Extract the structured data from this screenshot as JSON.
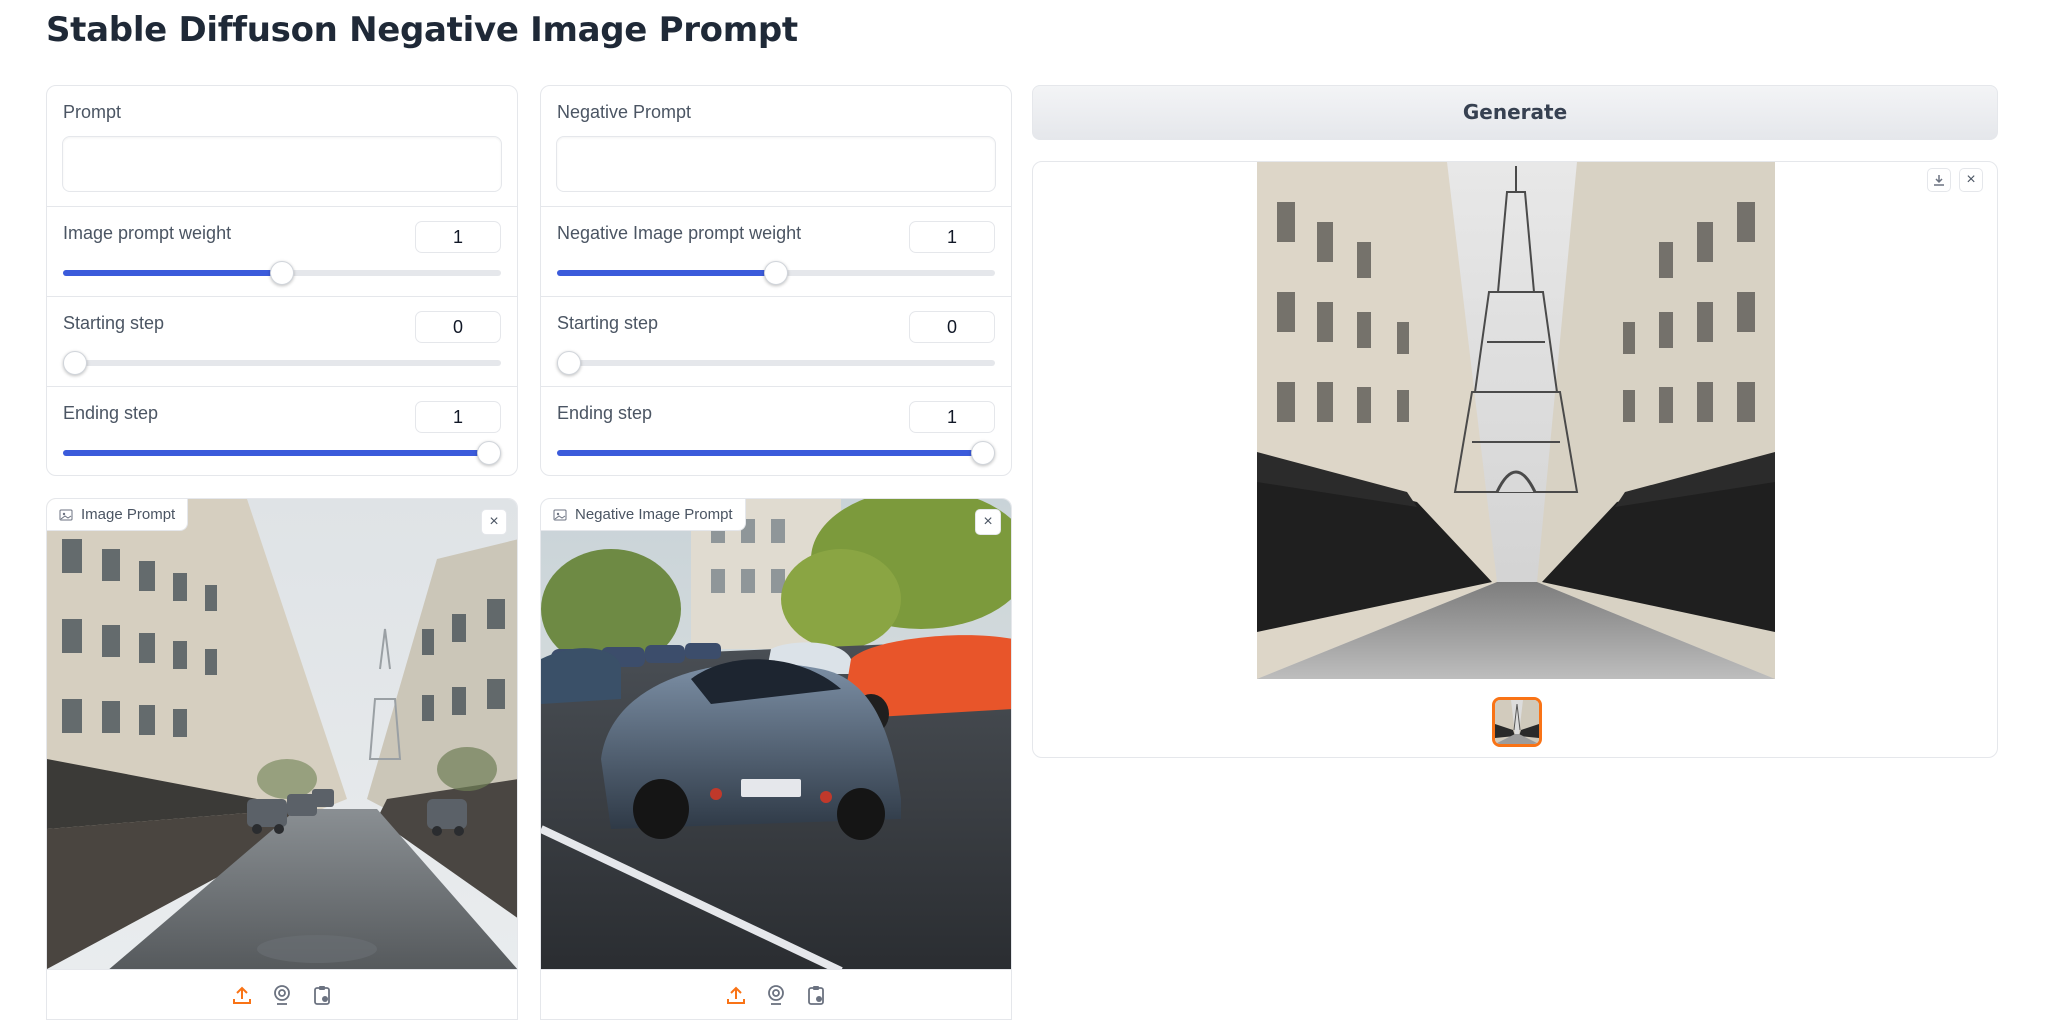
{
  "page": {
    "title": "Stable Diffuson Negative Image Prompt"
  },
  "left_controls": {
    "prompt_label": "Prompt",
    "prompt_value": "",
    "weight_label": "Image prompt weight",
    "weight_value": "1",
    "weight_fraction": 0.5,
    "start_label": "Starting step",
    "start_value": "0",
    "start_fraction": 0.0,
    "end_label": "Ending step",
    "end_value": "1",
    "end_fraction": 1.0
  },
  "right_controls": {
    "prompt_label": "Negative Prompt",
    "prompt_value": "",
    "weight_label": "Negative Image prompt weight",
    "weight_value": "1",
    "weight_fraction": 0.5,
    "start_label": "Starting step",
    "start_value": "0",
    "start_fraction": 0.0,
    "end_label": "Ending step",
    "end_value": "1",
    "end_fraction": 1.0
  },
  "generate": {
    "label": "Generate"
  },
  "image_prompt": {
    "label": "Image Prompt",
    "close": "×"
  },
  "negative_image_prompt": {
    "label": "Negative Image Prompt",
    "close": "×"
  },
  "output": {
    "close": "×"
  },
  "colors": {
    "accent": "#3b5bdb",
    "upload_icon": "#f97316",
    "thumbnail_border": "#f97316"
  },
  "icons": [
    "image-icon",
    "close-icon",
    "upload-icon",
    "webcam-icon",
    "clipboard-icon",
    "download-icon"
  ]
}
